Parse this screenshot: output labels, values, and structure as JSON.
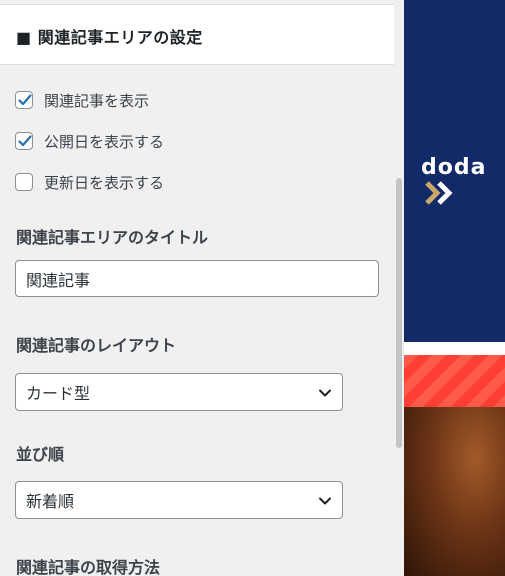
{
  "panel": {
    "title": "■ 関連記事エリアの設定",
    "checkboxes": [
      {
        "label": "関連記事を表示",
        "checked": true
      },
      {
        "label": "公開日を表示する",
        "checked": true
      },
      {
        "label": "更新日を表示する",
        "checked": false
      }
    ],
    "title_field": {
      "label": "関連記事エリアのタイトル",
      "value": "関連記事"
    },
    "layout_field": {
      "label": "関連記事のレイアウト",
      "value": "カード型"
    },
    "order_field": {
      "label": "並び順",
      "value": "新着順"
    },
    "method_field": {
      "label": "関連記事の取得方法"
    }
  },
  "preview": {
    "banner_logo": "doda"
  },
  "colors": {
    "checkbox_check": "#2271b1",
    "banner_bg": "#132a69",
    "stripe": "#ff4b3e"
  }
}
